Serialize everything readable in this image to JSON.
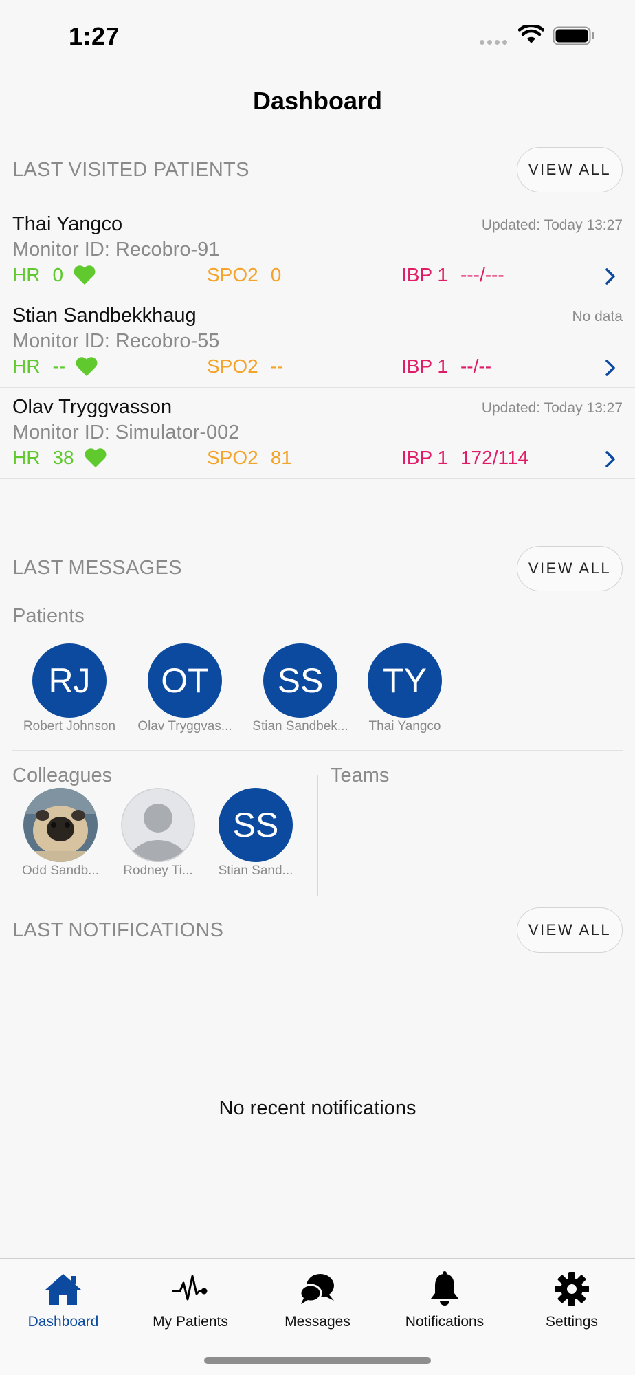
{
  "status_bar": {
    "time": "1:27"
  },
  "nav": {
    "title": "Dashboard"
  },
  "last_visited": {
    "header": "LAST VISITED PATIENTS",
    "view_all": "VIEW ALL",
    "patients": [
      {
        "name": "Thai Yangco",
        "updated": "Updated: Today 13:27",
        "monitor": "Monitor ID: Recobro-91",
        "hr_label": "HR",
        "hr": "0",
        "spo2_label": "SPO2",
        "spo2": "0",
        "ibp_label": "IBP 1",
        "ibp": "---/---"
      },
      {
        "name": "Stian Sandbekkhaug",
        "updated": "No data",
        "monitor": "Monitor ID: Recobro-55",
        "hr_label": "HR",
        "hr": "--",
        "spo2_label": "SPO2",
        "spo2": "--",
        "ibp_label": "IBP 1",
        "ibp": "--/--"
      },
      {
        "name": "Olav Tryggvasson",
        "updated": "Updated: Today 13:27",
        "monitor": "Monitor ID: Simulator-002",
        "hr_label": "HR",
        "hr": "38",
        "spo2_label": "SPO2",
        "spo2": "81",
        "ibp_label": "IBP 1",
        "ibp": "172/114"
      }
    ]
  },
  "last_messages": {
    "header": "LAST MESSAGES",
    "view_all": "VIEW ALL",
    "patients_label": "Patients",
    "patients": [
      {
        "initials": "RJ",
        "name": "Robert Johnson"
      },
      {
        "initials": "OT",
        "name": "Olav Tryggvas..."
      },
      {
        "initials": "SS",
        "name": "Stian Sandbek..."
      },
      {
        "initials": "TY",
        "name": "Thai Yangco"
      }
    ],
    "colleagues_label": "Colleagues",
    "colleagues": [
      {
        "initials": "",
        "name": "Odd Sandb...",
        "avatar": "photo"
      },
      {
        "initials": "",
        "name": "Rodney Ti...",
        "avatar": "placeholder"
      },
      {
        "initials": "SS",
        "name": "Stian Sand...",
        "avatar": "initials"
      }
    ],
    "teams_label": "Teams"
  },
  "last_notifications": {
    "header": "LAST NOTIFICATIONS",
    "view_all": "VIEW ALL",
    "empty": "No recent notifications"
  },
  "tabbar": {
    "tabs": [
      {
        "label": "Dashboard",
        "icon": "home-icon",
        "active": true
      },
      {
        "label": "My Patients",
        "icon": "heartbeat-icon",
        "active": false
      },
      {
        "label": "Messages",
        "icon": "chat-bubbles-icon",
        "active": false
      },
      {
        "label": "Notifications",
        "icon": "bell-icon",
        "active": false
      },
      {
        "label": "Settings",
        "icon": "gear-icon",
        "active": false
      }
    ]
  },
  "colors": {
    "accent": "#0c4aa0",
    "hr": "#5fc92e",
    "spo2": "#f4a42a",
    "ibp": "#e01c67",
    "secondary_text": "#8a8a8a"
  }
}
